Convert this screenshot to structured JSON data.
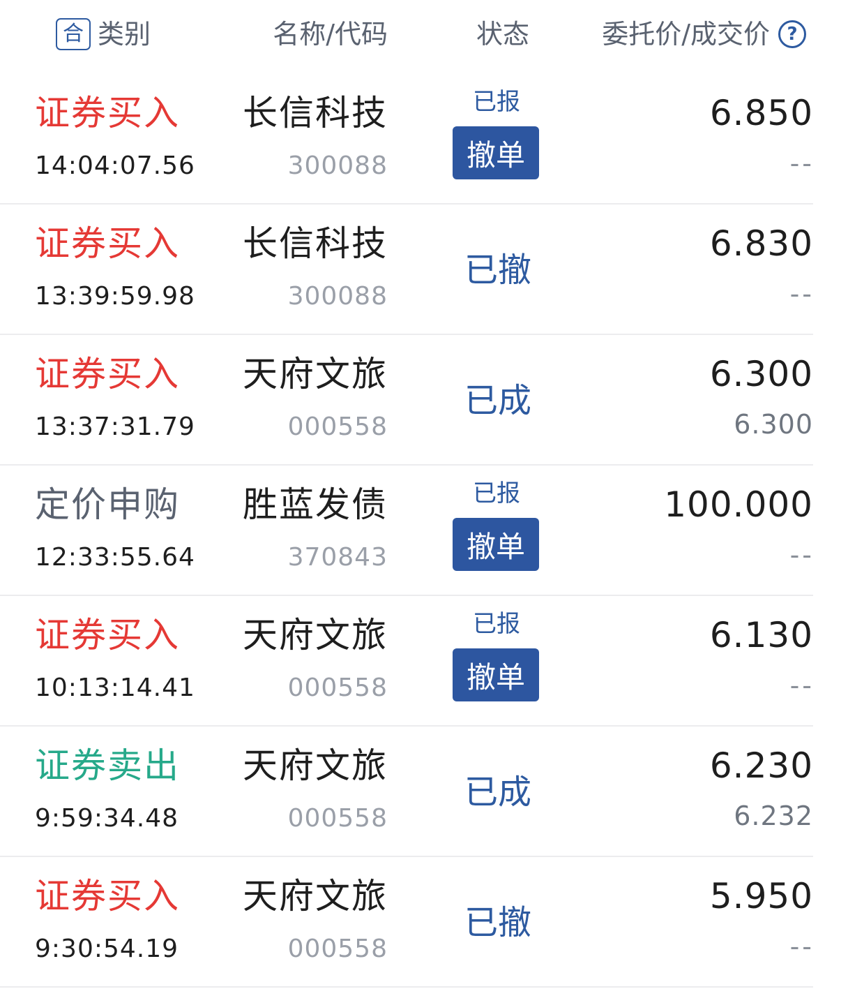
{
  "header": {
    "icon_char": "合",
    "type_label": "类别",
    "name_label": "名称/代码",
    "status_label": "状态",
    "price_label": "委托价/成交价",
    "help_char": "?"
  },
  "orders": [
    {
      "type": "证券买入",
      "type_kind": "buy",
      "time": "14:04:07.56",
      "name": "长信科技",
      "code": "300088",
      "status": "已报",
      "cancel_label": "撤单",
      "price": "6.850",
      "deal": "--"
    },
    {
      "type": "证券买入",
      "type_kind": "buy",
      "time": "13:39:59.98",
      "name": "长信科技",
      "code": "300088",
      "status": "已撤",
      "price": "6.830",
      "deal": "--"
    },
    {
      "type": "证券买入",
      "type_kind": "buy",
      "time": "13:37:31.79",
      "name": "天府文旅",
      "code": "000558",
      "status": "已成",
      "price": "6.300",
      "deal": "6.300"
    },
    {
      "type": "定价申购",
      "type_kind": "sub",
      "time": "12:33:55.64",
      "name": "胜蓝发债",
      "code": "370843",
      "status": "已报",
      "cancel_label": "撤单",
      "price": "100.000",
      "deal": "--"
    },
    {
      "type": "证券买入",
      "type_kind": "buy",
      "time": "10:13:14.41",
      "name": "天府文旅",
      "code": "000558",
      "status": "已报",
      "cancel_label": "撤单",
      "price": "6.130",
      "deal": "--"
    },
    {
      "type": "证券卖出",
      "type_kind": "sell",
      "time": "9:59:34.48",
      "name": "天府文旅",
      "code": "000558",
      "status": "已成",
      "price": "6.230",
      "deal": "6.232"
    },
    {
      "type": "证券买入",
      "type_kind": "buy",
      "time": "9:30:54.19",
      "name": "天府文旅",
      "code": "000558",
      "status": "已撤",
      "price": "5.950",
      "deal": "--"
    }
  ]
}
